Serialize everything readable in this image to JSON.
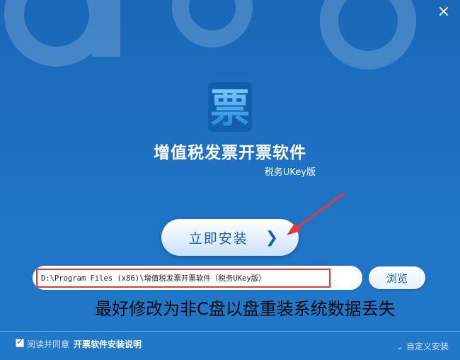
{
  "window": {
    "close_glyph": "×"
  },
  "app": {
    "title": "增值税发票开票软件",
    "subtitle": "税务UKey版",
    "logo_glyph": "票"
  },
  "install": {
    "label": "立即安装",
    "chevron": "❯"
  },
  "path": {
    "value": "D:\\Program Files (x86)\\增值税发票开票软件（税务UKey版）"
  },
  "browse_label": "浏览",
  "annotation": "最好修改为非C盘以盘重装系统数据丢失",
  "footer": {
    "agree_text": "阅读并同意",
    "license_link": "开票软件安装说明",
    "agree_checked": true,
    "check_glyph": "✓",
    "custom_install_label": "自定义安装",
    "custom_chevron": "⌄"
  },
  "colors": {
    "accent": "#1e5fa7",
    "background": "#1f72c3",
    "highlight": "#e03a3a"
  }
}
